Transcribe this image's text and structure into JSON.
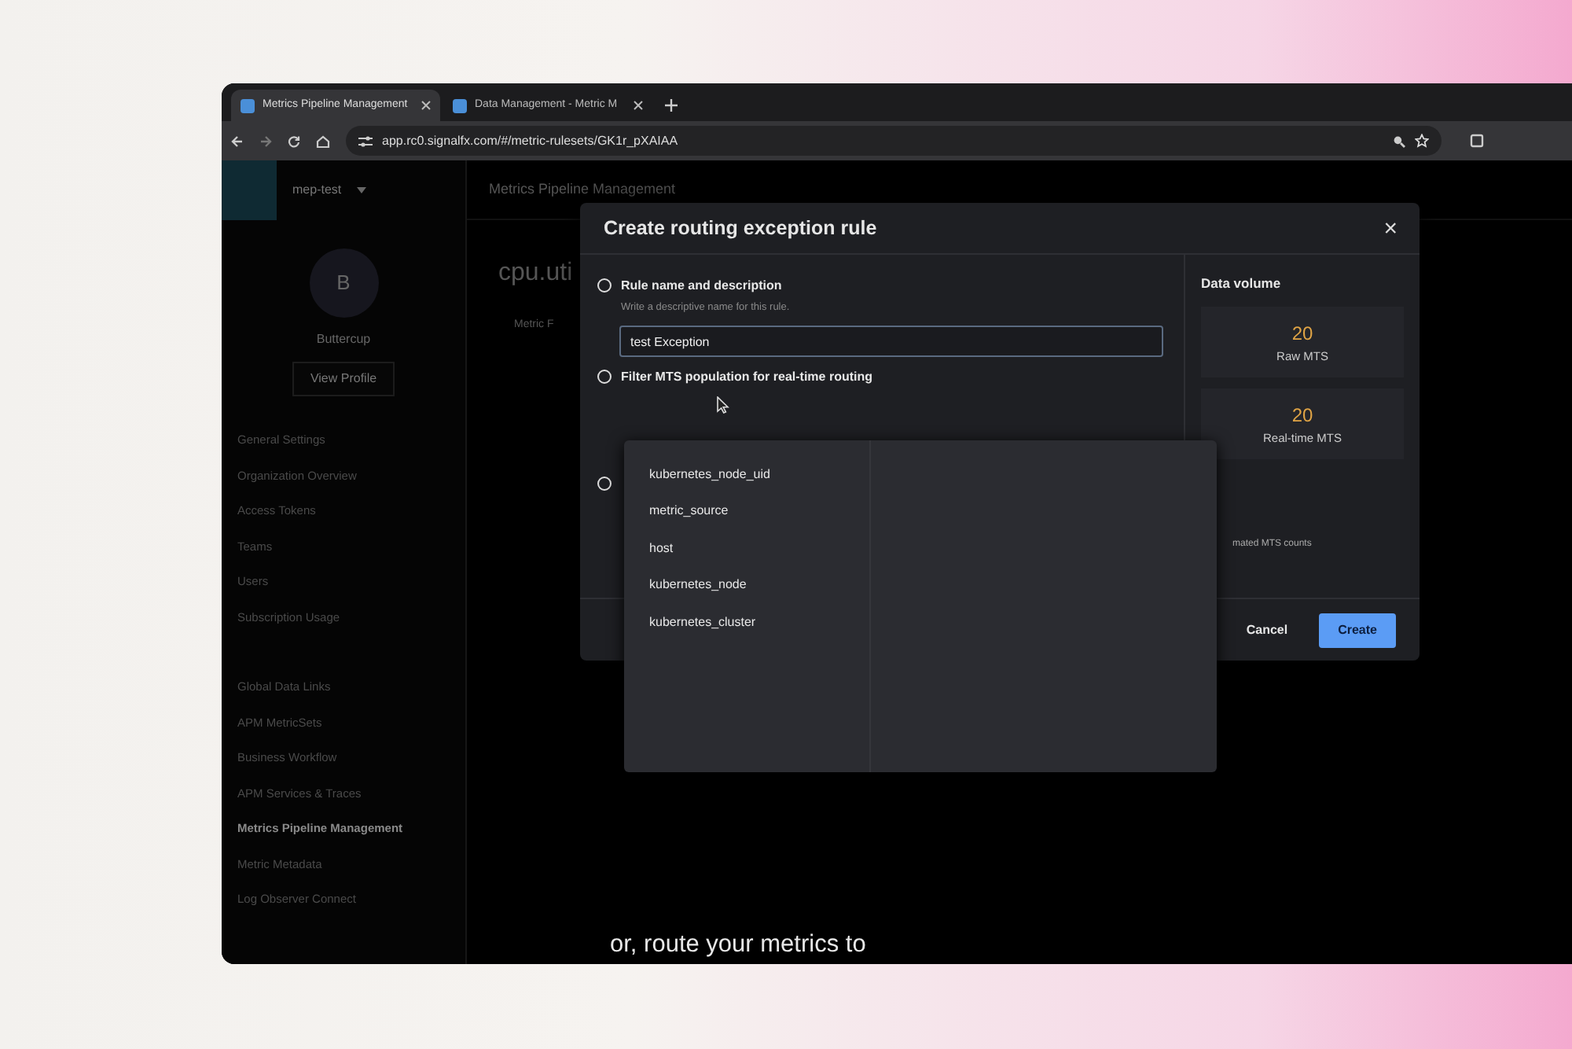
{
  "browser": {
    "tabs": [
      {
        "title": "Metrics Pipeline Management",
        "selected": true
      },
      {
        "title": "Data Management - Metric M",
        "selected": false
      }
    ],
    "url": "app.rc0.signalfx.com/#/metric-rulesets/GK1r_pXAIAA"
  },
  "app": {
    "org": "mep-test",
    "page_title": "Metrics Pipeline Management",
    "profile": {
      "initial": "B",
      "name": "Buttercup",
      "button": "View Profile"
    },
    "nav": [
      {
        "label": "General Settings",
        "selected": false
      },
      {
        "label": "Organization Overview",
        "selected": false
      },
      {
        "label": "Access Tokens",
        "selected": false
      },
      {
        "label": "Teams",
        "selected": false
      },
      {
        "label": "Users",
        "selected": false
      },
      {
        "label": "Subscription Usage",
        "selected": false
      },
      {
        "label": "Global Data Links",
        "selected": false
      },
      {
        "label": "APM MetricSets",
        "selected": false
      },
      {
        "label": "Business Workflow",
        "selected": false
      },
      {
        "label": "APM Services & Traces",
        "selected": false
      },
      {
        "label": "Metrics Pipeline Management",
        "selected": true
      },
      {
        "label": "Metric Metadata",
        "selected": false
      },
      {
        "label": "Log Observer Connect",
        "selected": false
      }
    ],
    "metric_title": "cpu.uti",
    "tab": "Metric F"
  },
  "modal": {
    "title": "Create routing exception rule",
    "close": "×",
    "steps": [
      {
        "title": "Rule name and description",
        "checked": false,
        "hint": "Write a descriptive name for this rule.",
        "value": "test Exception"
      },
      {
        "title": "Filter MTS population for real-time routing",
        "checked": false
      },
      {
        "checked": false
      }
    ],
    "data_volume": {
      "title": "Data volume",
      "stats": [
        {
          "value": "20",
          "label": "Raw MTS"
        },
        {
          "value": "20",
          "label": "Real-time MTS"
        }
      ],
      "note": "mated MTS counts"
    },
    "cancel": "Cancel",
    "create": "Create"
  },
  "dropdown": {
    "options": [
      "kubernetes_node_uid",
      "metric_source",
      "host",
      "kubernetes_node",
      "kubernetes_cluster"
    ]
  },
  "caption": "or, route your metrics to"
}
